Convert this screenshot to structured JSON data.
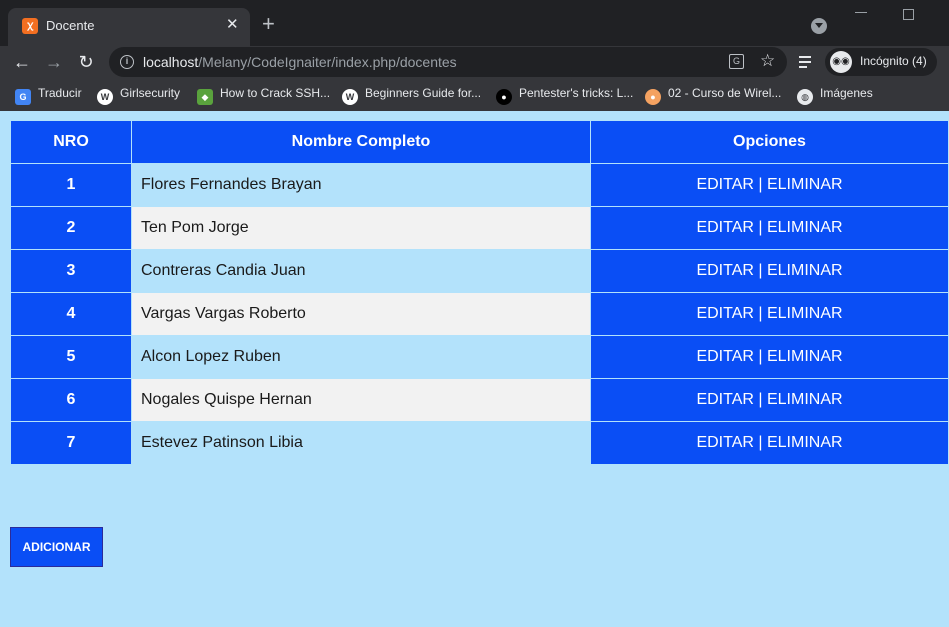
{
  "browser": {
    "tab_title": "Docente",
    "url_host": "localhost",
    "url_path": "/Melany/CodeIgnaiter/index.php/docentes",
    "incognito_label": "Incógnito (4)",
    "bookmarks": [
      {
        "label": "Traducir",
        "icon": "google-translate-icon"
      },
      {
        "label": "Girlsecurity",
        "icon": "wordpress-icon"
      },
      {
        "label": "How to Crack SSH...",
        "icon": "hex-icon"
      },
      {
        "label": "Beginners Guide for...",
        "icon": "wordpress-icon"
      },
      {
        "label": "Pentester's tricks: L...",
        "icon": "medium-icon"
      },
      {
        "label": "02 - Curso de Wirel...",
        "icon": "xampp-icon"
      },
      {
        "label": "Imágenes",
        "icon": "globe-icon"
      }
    ]
  },
  "table": {
    "headers": {
      "nro": "NRO",
      "name": "Nombre Completo",
      "options": "Opciones"
    },
    "rows": [
      {
        "nro": "1",
        "name": "Flores Fernandes Brayan",
        "edit": "EDITAR",
        "sep": "|",
        "delete": "ELIMINAR"
      },
      {
        "nro": "2",
        "name": "Ten Pom Jorge",
        "edit": "EDITAR",
        "sep": "|",
        "delete": "ELIMINAR"
      },
      {
        "nro": "3",
        "name": "Contreras Candia Juan",
        "edit": "EDITAR",
        "sep": "|",
        "delete": "ELIMINAR"
      },
      {
        "nro": "4",
        "name": "Vargas Vargas Roberto",
        "edit": "EDITAR",
        "sep": "|",
        "delete": "ELIMINAR"
      },
      {
        "nro": "5",
        "name": "Alcon Lopez Ruben",
        "edit": "EDITAR",
        "sep": "|",
        "delete": "ELIMINAR"
      },
      {
        "nro": "6",
        "name": "Nogales Quispe Hernan",
        "edit": "EDITAR",
        "sep": "|",
        "delete": "ELIMINAR"
      },
      {
        "nro": "7",
        "name": "Estevez Patinson Libia",
        "edit": "EDITAR",
        "sep": "|",
        "delete": "ELIMINAR"
      }
    ]
  },
  "add_button": "ADICIONAR",
  "colors": {
    "header_blue": "#0a4ef5",
    "page_bg": "#b3e2fb",
    "row_alt": "#f2f2f2"
  }
}
